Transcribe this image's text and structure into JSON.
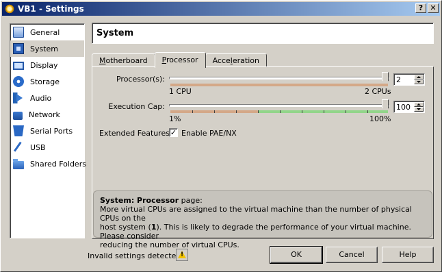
{
  "window": {
    "title": "VB1 - Settings",
    "help_button": "?",
    "close_button": "✕"
  },
  "sidebar": {
    "items": [
      {
        "label": "General",
        "icon": "general-icon"
      },
      {
        "label": "System",
        "icon": "system-icon",
        "selected": true
      },
      {
        "label": "Display",
        "icon": "display-icon"
      },
      {
        "label": "Storage",
        "icon": "storage-icon"
      },
      {
        "label": "Audio",
        "icon": "audio-icon"
      },
      {
        "label": "Network",
        "icon": "network-icon"
      },
      {
        "label": "Serial Ports",
        "icon": "serial-ports-icon"
      },
      {
        "label": "USB",
        "icon": "usb-icon"
      },
      {
        "label": "Shared Folders",
        "icon": "shared-folders-icon"
      }
    ]
  },
  "header": {
    "title": "System"
  },
  "tabs": [
    {
      "label": "Motherboard",
      "mnemonic": "M",
      "rest": "otherboard"
    },
    {
      "label": "Processor",
      "mnemonic": "P",
      "rest": "rocessor",
      "active": true
    },
    {
      "label": "Acceleration",
      "mnemonic": "l",
      "pre": "Acce",
      "rest": "eration"
    }
  ],
  "processor": {
    "processors_label": "Processor(s):",
    "processors_min_label": "1 CPU",
    "processors_max_label": "2 CPUs",
    "processors_value": "2",
    "exec_cap_label": "Execution Cap:",
    "exec_cap_min_label": "1%",
    "exec_cap_max_label": "100%",
    "exec_cap_value": "100",
    "extended_label": "Extended Features:",
    "pae_label": "Enable PAE/NX",
    "pae_checked": true
  },
  "info": {
    "title_bold": "System: Processor",
    "title_rest": " page:",
    "line1": "More virtual CPUs are assigned to the virtual machine than the number of physical CPUs on the",
    "line2_pre": "host system (",
    "line2_bold": "1",
    "line2_post": "). This is likely to degrade the performance of your virtual machine. Please consider",
    "line3": "reducing the number of virtual CPUs."
  },
  "footer": {
    "status": "Invalid settings detected",
    "ok": "OK",
    "cancel": "Cancel",
    "help": "Help"
  },
  "colors": {
    "title_start": "#0a246a",
    "title_end": "#a6caf0",
    "range_warn": "#d4a888",
    "range_ok": "#92d58a"
  }
}
